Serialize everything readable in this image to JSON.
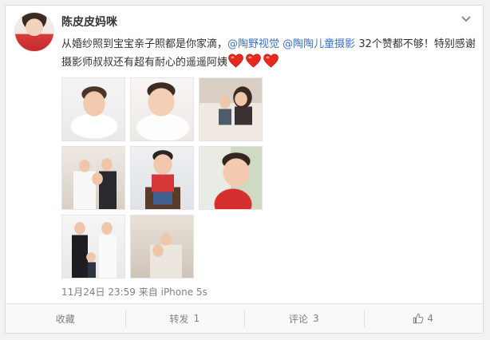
{
  "post": {
    "username": "陈皮皮妈咪",
    "text_before": "从婚纱照到宝宝亲子照都是你家滴，",
    "mention_1": "@陶野视觉",
    "text_between": " ",
    "mention_2": "@陶陶儿童摄影",
    "text_after": " 32个赞都不够！特别感谢摄影师叔叔还有超有耐心的遥遥阿姨",
    "emoji_heart_count": 3,
    "heart_color": "#e8271d",
    "mention_color": "#3e71c0",
    "timestamp": "11月24日 23:59",
    "source_prefix": "来自",
    "source": "iPhone 5s",
    "photo_count": 8
  },
  "icons": {
    "menu": "chevron-down-icon",
    "like": "thumbs-up-icon",
    "emoji": "heart-emoji-icon"
  },
  "actions": {
    "favorite_label": "收藏",
    "repost_label": "转发",
    "repost_count": "1",
    "comment_label": "评论",
    "comment_count": "3",
    "like_count": "4"
  }
}
